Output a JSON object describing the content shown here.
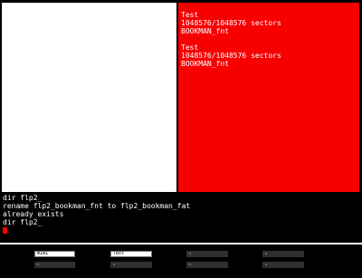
{
  "display_pane": {
    "blocks": [
      {
        "name": "Test",
        "sectors": "1048576/1048576 sectors",
        "file": "BOOKMAN_fnt"
      },
      {
        "name": "Test",
        "sectors": "1048576/1048576 sectors",
        "file": "BOOKMAN_fnt"
      }
    ]
  },
  "console": {
    "lines": [
      "dir flp2_",
      "rename flp2_bookman_fnt to flp2_bookman_fat",
      "already exists",
      "dir flp2_"
    ]
  },
  "function_keys": {
    "row1": [
      "WIN1",
      "Test",
      "",
      "",
      ""
    ],
    "row2": [
      "",
      "",
      "",
      "",
      ""
    ]
  },
  "colors": {
    "display_background": "#f60000",
    "cursor": "#ff0000"
  }
}
